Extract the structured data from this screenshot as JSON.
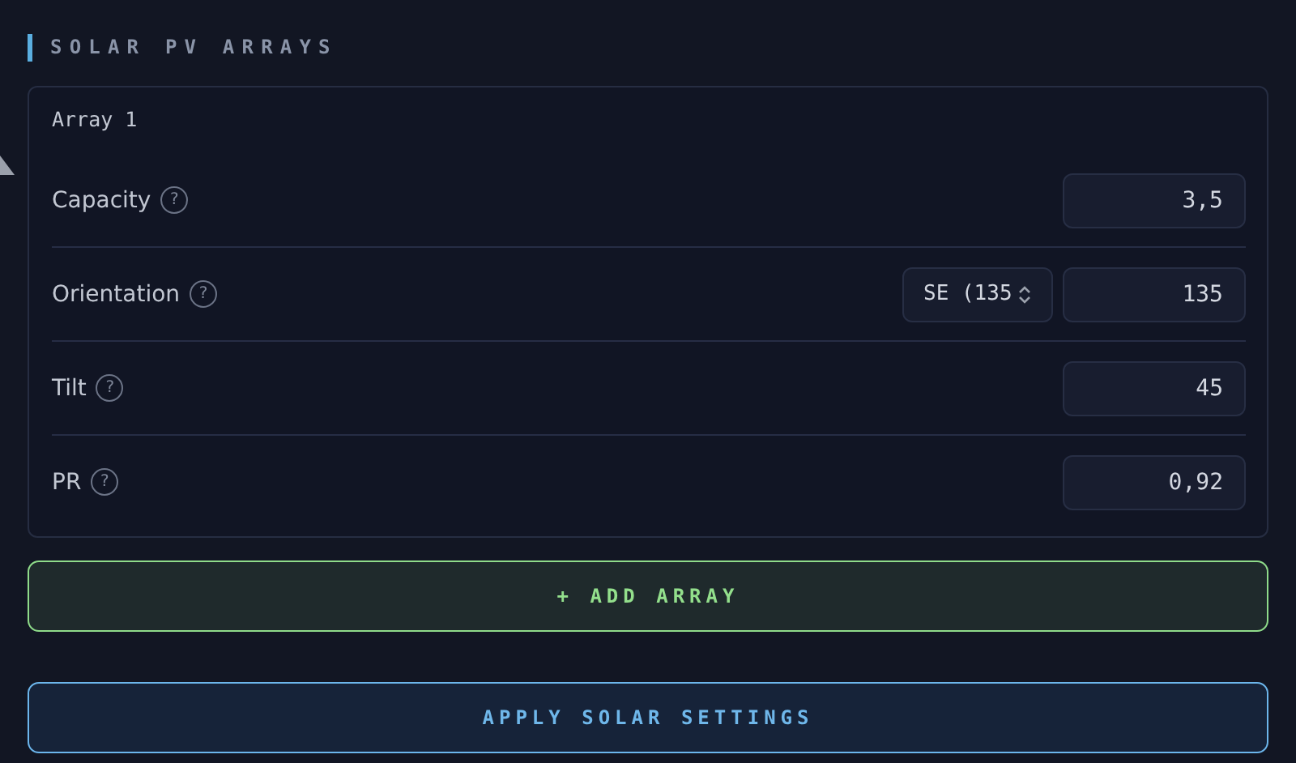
{
  "section": {
    "title": "SOLAR PV ARRAYS"
  },
  "arrays": [
    {
      "title": "Array 1",
      "fields": [
        {
          "label": "Capacity",
          "help": "?",
          "value": "3,5"
        },
        {
          "label": "Orientation",
          "help": "?",
          "select": "SE (135",
          "value": "135"
        },
        {
          "label": "Tilt",
          "help": "?",
          "value": "45"
        },
        {
          "label": "PR",
          "help": "?",
          "value": "0,92"
        }
      ]
    }
  ],
  "buttons": [
    {
      "kind": "add",
      "label": "+ ADD ARRAY"
    },
    {
      "kind": "apply",
      "label": "APPLY SOLAR SETTINGS"
    }
  ]
}
